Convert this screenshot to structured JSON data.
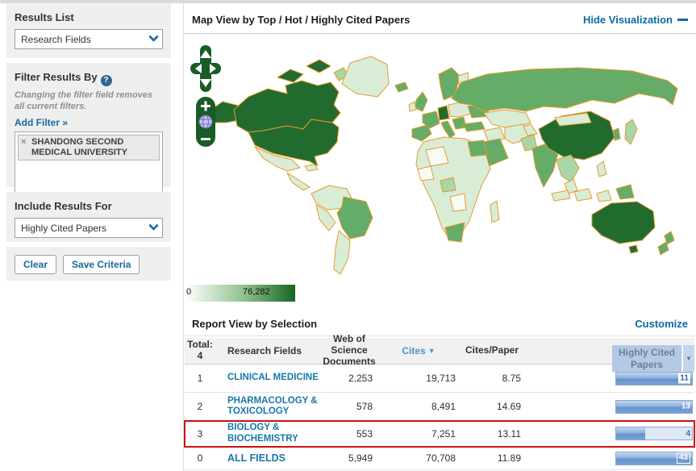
{
  "sidebar": {
    "results_list_label": "Results List",
    "results_list_value": "Research Fields",
    "filter_label": "Filter Results By",
    "filter_note": "Changing the filter field removes all current filters.",
    "add_filter_link": "Add Filter »",
    "filter_chip_remove": "×",
    "filter_chip": "SHANDONG SECOND MEDICAL UNIVERSITY",
    "include_label": "Include Results For",
    "include_value": "Highly Cited Papers",
    "clear_button": "Clear",
    "save_button": "Save Criteria",
    "help_icon_glyph": "?"
  },
  "map": {
    "title": "Map View by Top / Hot / Highly Cited Papers",
    "hide_link": "Hide Visualization",
    "legend_min": "0",
    "legend_max": "76,282",
    "colors": {
      "low": "#ffffff",
      "high": "#16641f",
      "border": "#e59a2f",
      "dark_country": "#226b2f",
      "medium_country": "#64ac67",
      "pale_country": "#d9edd6"
    }
  },
  "report": {
    "title": "Report View by Selection",
    "customize_link": "Customize",
    "table": {
      "header": {
        "total_label": "Total:",
        "total_value": "4",
        "research_fields": "Research Fields",
        "documents": "Web of Science Documents",
        "cites": "Cites",
        "sort_arrow": "▼",
        "cites_per_paper": "Cites/Paper",
        "highly_cited": "Highly Cited Papers",
        "column_menu_arrow": "▼"
      },
      "rows": [
        {
          "rank": "1",
          "field": "CLINICAL MEDICINE",
          "documents": "2,253",
          "cites": "19,713",
          "cites_per_paper": "8.75",
          "highly_cited": "11",
          "bar_pct": 100,
          "label_style": "chip",
          "highlighted": false,
          "bold": false
        },
        {
          "rank": "2",
          "field": "PHARMACOLOGY & TOXICOLOGY",
          "documents": "578",
          "cites": "8,491",
          "cites_per_paper": "14.69",
          "highly_cited": "13",
          "bar_pct": 100,
          "label_style": "fill",
          "highlighted": false,
          "bold": false
        },
        {
          "rank": "3",
          "field": "BIOLOGY & BIOCHEMISTRY",
          "documents": "553",
          "cites": "7,251",
          "cites_per_paper": "13.11",
          "highly_cited": "4",
          "bar_pct": 38,
          "label_style": "track",
          "highlighted": true,
          "bold": false
        },
        {
          "rank": "0",
          "field": "ALL FIELDS",
          "documents": "5,949",
          "cites": "70,708",
          "cites_per_paper": "11.89",
          "highly_cited": "43",
          "bar_pct": 100,
          "label_style": "fill-box",
          "highlighted": false,
          "bold": true
        }
      ]
    }
  }
}
